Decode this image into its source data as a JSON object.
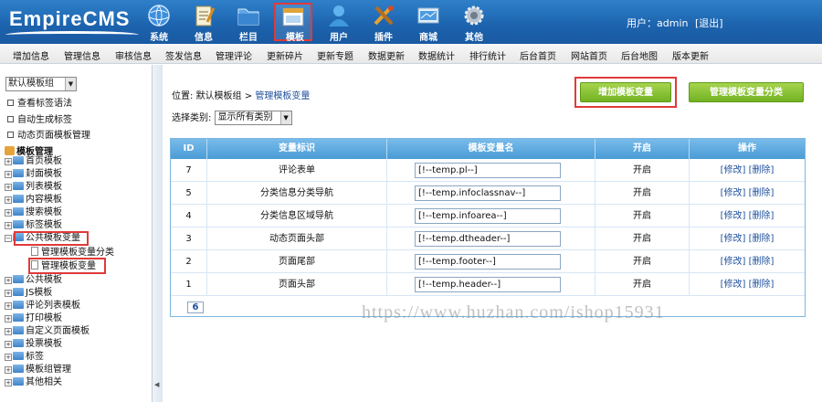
{
  "header": {
    "logo": "EmpireCMS",
    "nav": [
      {
        "label": "系统",
        "icon": "globe-icon"
      },
      {
        "label": "信息",
        "icon": "notepad-icon"
      },
      {
        "label": "栏目",
        "icon": "folder-icon"
      },
      {
        "label": "模板",
        "icon": "window-template-icon",
        "active": true
      },
      {
        "label": "用户",
        "icon": "user-icon"
      },
      {
        "label": "插件",
        "icon": "tools-icon"
      },
      {
        "label": "商城",
        "icon": "shop-icon"
      },
      {
        "label": "其他",
        "icon": "gear-icon"
      }
    ],
    "user_prefix": "用户：",
    "username": "admin",
    "logout": "[退出]"
  },
  "submenu": [
    "增加信息",
    "管理信息",
    "审核信息",
    "签发信息",
    "管理评论",
    "更新碎片",
    "更新专题",
    "数据更新",
    "数据统计",
    "排行统计",
    "后台首页",
    "网站首页",
    "后台地图",
    "版本更新"
  ],
  "sidebar": {
    "group_select": "默认模板组",
    "links": [
      "查看标签语法",
      "自动生成标签",
      "动态页面模板管理"
    ],
    "tree_title": "模板管理",
    "tree": [
      "首页模板",
      "封面模板",
      "列表模板",
      "内容模板",
      "搜索模板",
      "标签模板",
      "公共模板变量"
    ],
    "tree_children": [
      "管理模板变量分类",
      "管理模板变量"
    ],
    "tree_after": [
      "公共模板",
      "JS模板",
      "评论列表模板",
      "打印模板",
      "自定义页面模板",
      "投票模板",
      "标签",
      "模板组管理",
      "其他相关"
    ]
  },
  "main": {
    "breadcrumb_prefix": "位置:",
    "breadcrumb_group": "默认模板组",
    "breadcrumb_sep": ">",
    "breadcrumb_current": "管理模板变量",
    "filter_label": "选择类别:",
    "filter_value": "显示所有类别",
    "add_button": "增加模板变量",
    "manage_class_button": "管理模板变量分类",
    "columns": [
      "ID",
      "变量标识",
      "模板变量名",
      "开启",
      "操作"
    ],
    "rows": [
      {
        "id": "7",
        "ident": "评论表单",
        "var": "[!--temp.pl--]",
        "enabled": "开启"
      },
      {
        "id": "5",
        "ident": "分类信息分类导航",
        "var": "[!--temp.infoclassnav--]",
        "enabled": "开启"
      },
      {
        "id": "4",
        "ident": "分类信息区域导航",
        "var": "[!--temp.infoarea--]",
        "enabled": "开启"
      },
      {
        "id": "3",
        "ident": "动态页面头部",
        "var": "[!--temp.dtheader--]",
        "enabled": "开启"
      },
      {
        "id": "2",
        "ident": "页面尾部",
        "var": "[!--temp.footer--]",
        "enabled": "开启"
      },
      {
        "id": "1",
        "ident": "页面头部",
        "var": "[!--temp.header--]",
        "enabled": "开启"
      }
    ],
    "edit_label": "[修改]",
    "delete_label": "[删除]",
    "total": "6"
  },
  "watermark": "https://www.huzhan.com/ishop15931"
}
